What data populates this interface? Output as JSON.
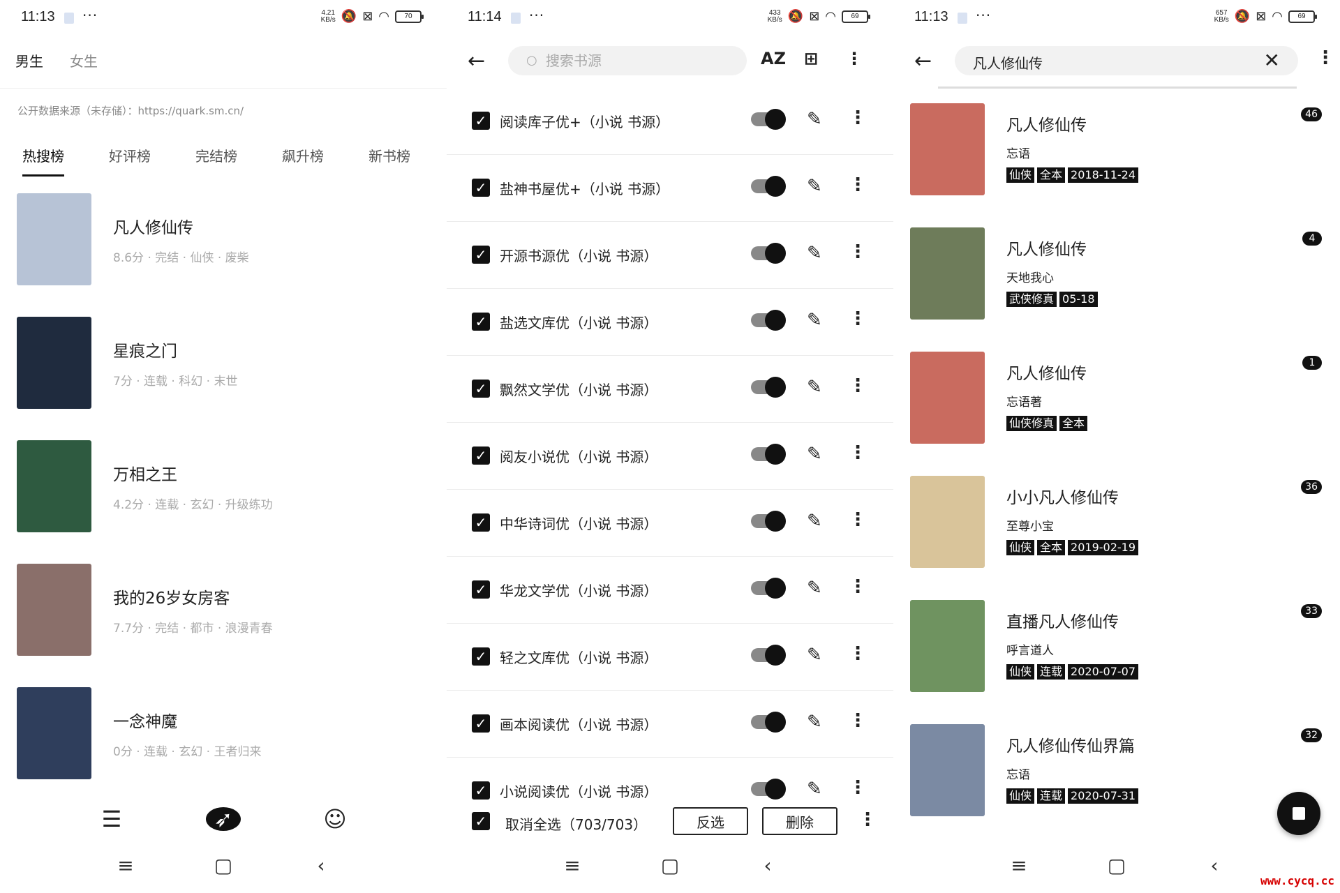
{
  "colors": {
    "accent": "#111111",
    "muted": "#aaaaaa"
  },
  "panel1": {
    "status": {
      "time": "11:13",
      "speed": "4.21\nKB/s",
      "battery": "70"
    },
    "gender_tabs": [
      "男生",
      "女生"
    ],
    "source": "公开数据来源（未存储）：https://quark.sm.cn/",
    "rank_tabs": [
      "热搜榜",
      "好评榜",
      "完结榜",
      "飙升榜",
      "新书榜"
    ],
    "books": [
      {
        "title": "凡人修仙传",
        "meta": "8.6分 · 完结 · 仙侠 · 废柴",
        "cover": "#b7c3d6"
      },
      {
        "title": "星痕之门",
        "meta": "7分 · 连载 · 科幻 · 末世",
        "cover": "#1f2b3e"
      },
      {
        "title": "万相之王",
        "meta": "4.2分 · 连载 · 玄幻 · 升级练功",
        "cover": "#2e5a40"
      },
      {
        "title": "我的26岁女房客",
        "meta": "7.7分 · 完结 · 都市 · 浪漫青春",
        "cover": "#8a6f6a"
      },
      {
        "title": "一念神魔",
        "meta": "0分 · 连载 · 玄幻 · 王者归来",
        "cover": "#2f3e5c"
      }
    ]
  },
  "panel2": {
    "status": {
      "time": "11:14",
      "speed": "433\nKB/s",
      "battery": "69"
    },
    "search_placeholder": "搜索书源",
    "az_label": "AZ",
    "sources": [
      "阅读库子优+（小说 书源）",
      "盐神书屋优+（小说 书源）",
      "开源书源优（小说 书源）",
      "盐选文库优（小说 书源）",
      "飘然文学优（小说 书源）",
      "阅友小说优（小说 书源）",
      "中华诗词优（小说 书源）",
      "华龙文学优（小说 书源）",
      "轻之文库优（小说 书源）",
      "画本阅读优（小说 书源）",
      "小说阅读优（小说 书源）"
    ],
    "select_all": "取消全选（703/703）",
    "invert": "反选",
    "delete": "删除"
  },
  "panel3": {
    "status": {
      "time": "11:13",
      "speed": "657\nKB/s",
      "battery": "69"
    },
    "query": "凡人修仙传",
    "results": [
      {
        "title": "凡人修仙传",
        "author": "忘语",
        "tags": [
          "仙侠",
          "全本",
          "2018-11-24"
        ],
        "count": "46",
        "cover": "#c96b5f"
      },
      {
        "title": "凡人修仙传",
        "author": "天地我心",
        "tags": [
          "武侠修真",
          "05-18"
        ],
        "count": "4",
        "cover": "#6e7c5a"
      },
      {
        "title": "凡人修仙传",
        "author": "忘语著",
        "tags": [
          "仙侠修真",
          "全本"
        ],
        "count": "1",
        "cover": "#c96b5f"
      },
      {
        "title": "小小凡人修仙传",
        "author": "至尊小宝",
        "tags": [
          "仙侠",
          "全本",
          "2019-02-19"
        ],
        "count": "36",
        "cover": "#d9c49a"
      },
      {
        "title": "直播凡人修仙传",
        "author": "呼言道人",
        "tags": [
          "仙侠",
          "连载",
          "2020-07-07"
        ],
        "count": "33",
        "cover": "#6f9360"
      },
      {
        "title": "凡人修仙传仙界篇",
        "author": "忘语",
        "tags": [
          "仙侠",
          "连载",
          "2020-07-31"
        ],
        "count": "32",
        "cover": "#7b8aa3"
      }
    ],
    "watermark": "www.cycq.cc"
  }
}
